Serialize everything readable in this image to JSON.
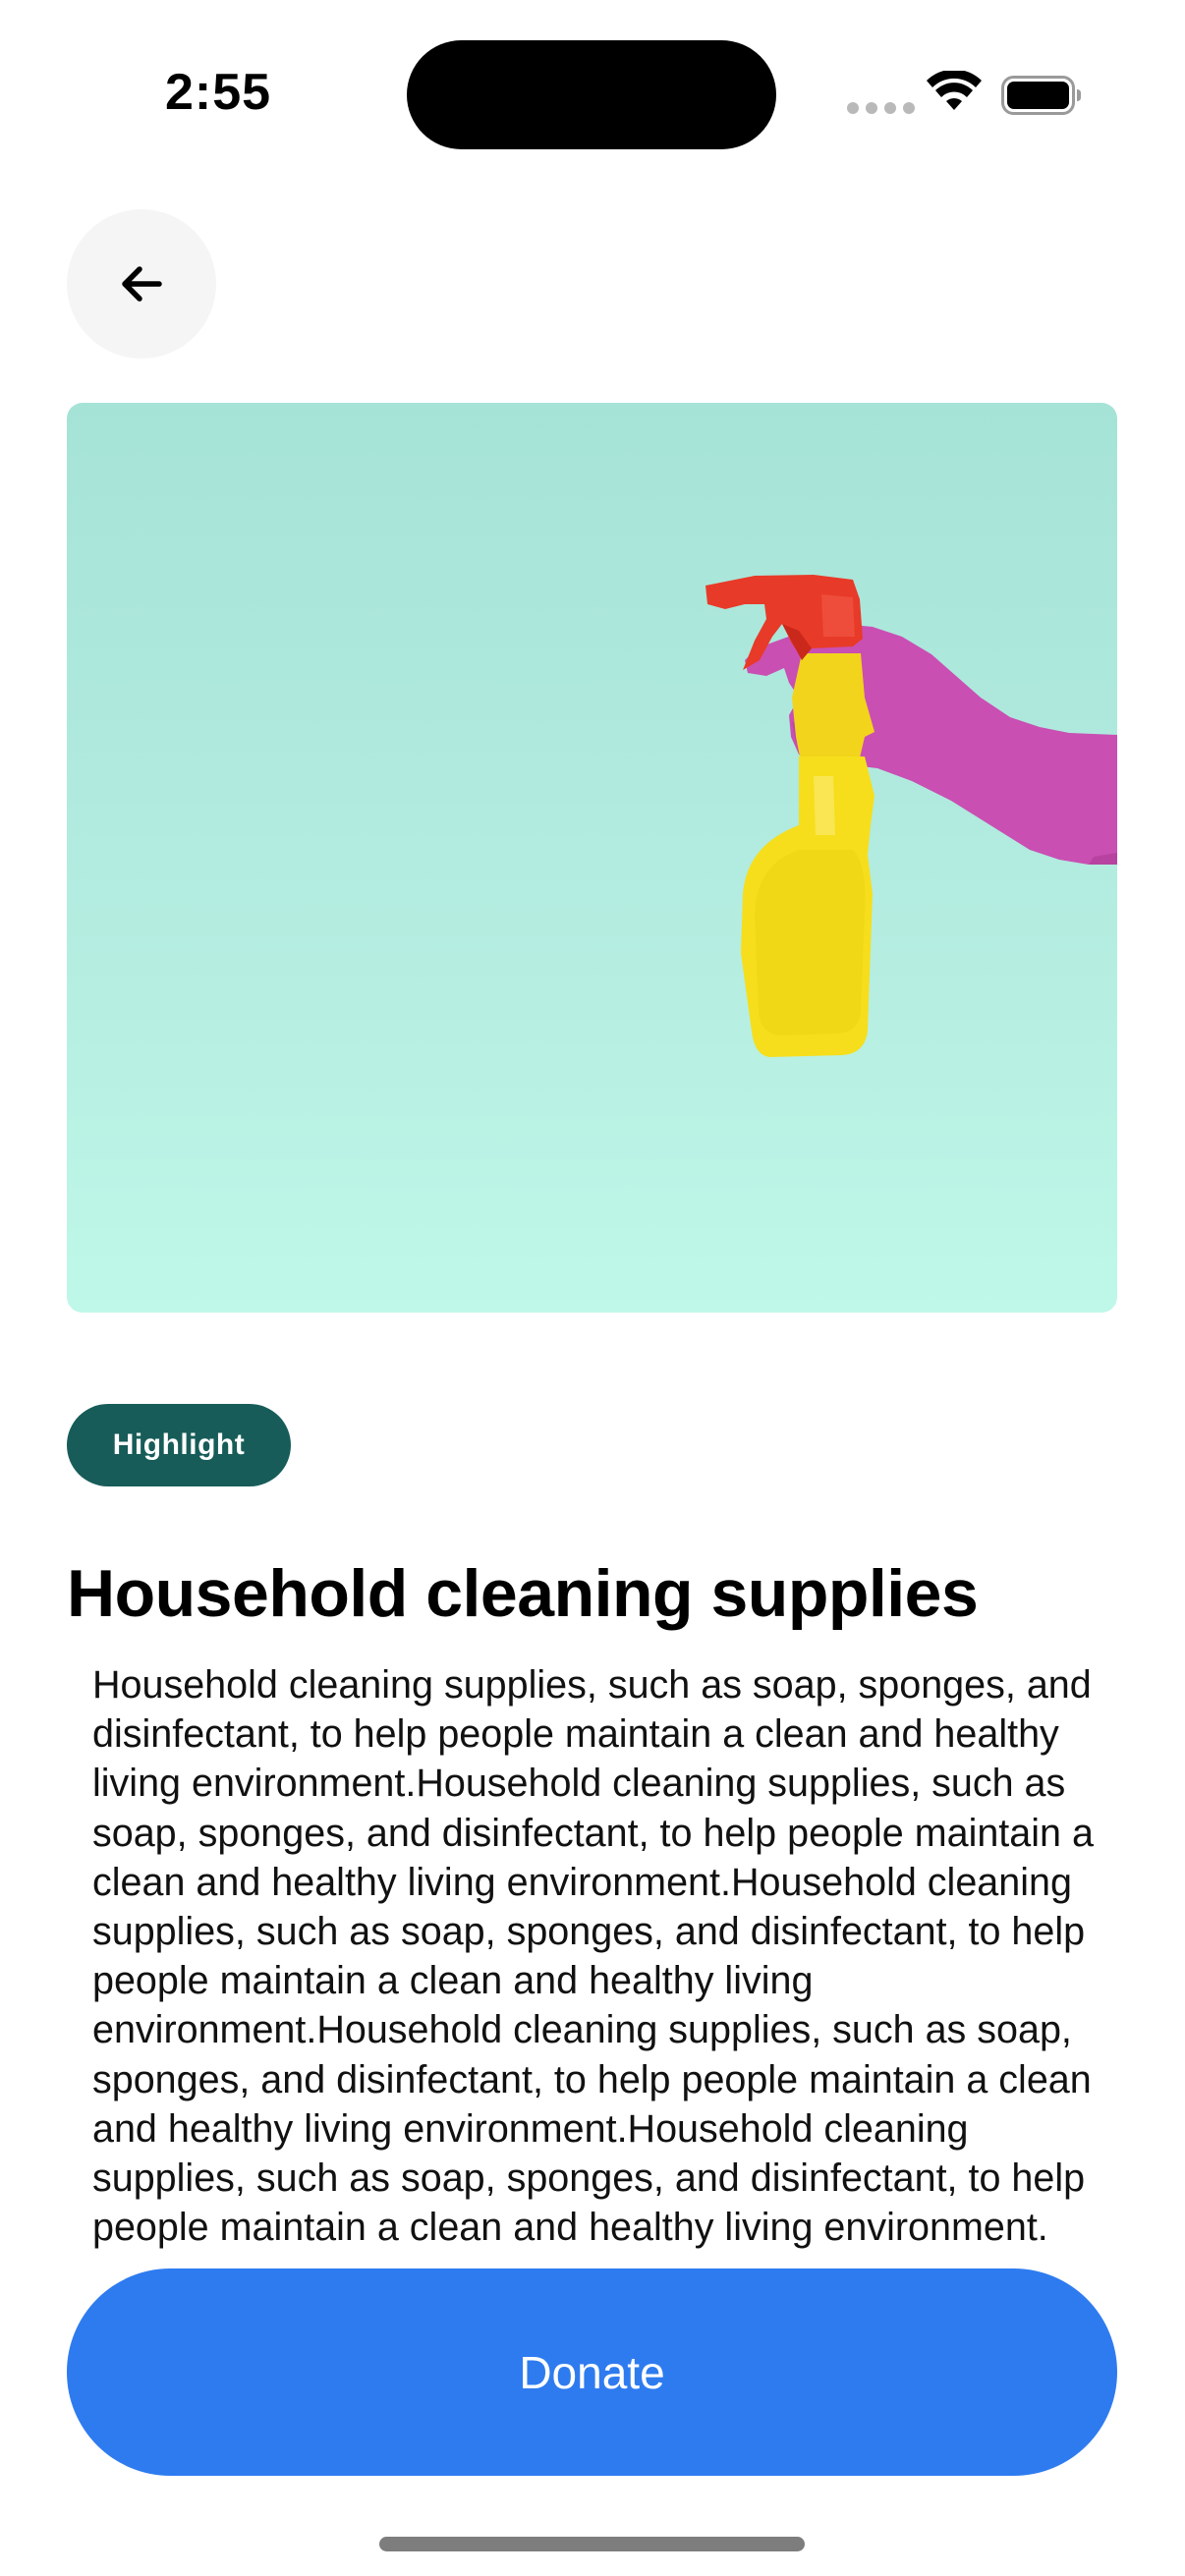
{
  "status_bar": {
    "time": "2:55",
    "signal_icon": "cellular-dots-icon",
    "wifi_icon": "wifi-icon",
    "battery_icon": "battery-full-icon"
  },
  "header": {
    "back_icon": "arrow-left-icon"
  },
  "hero": {
    "image_subject": "spray-bottle-glove-image",
    "background_color": "#abe6da"
  },
  "badge": {
    "label": "Highlight",
    "color": "#175c58"
  },
  "content": {
    "title": "Household cleaning supplies",
    "description": "Household cleaning supplies, such as soap, sponges, and disinfectant, to help people maintain a clean and healthy living environment.Household cleaning supplies, such as soap, sponges, and disinfectant, to help people maintain a clean and healthy living environment.Household cleaning supplies, such as soap, sponges, and disinfectant, to help people maintain a clean and healthy living environment.Household cleaning supplies, such as soap, sponges, and disinfectant, to help people maintain a clean and healthy living environment.Household cleaning supplies, such as soap, sponges, and disinfectant, to help people maintain a clean and healthy living environment."
  },
  "actions": {
    "donate_label": "Donate",
    "donate_color": "#2e7bf0"
  }
}
